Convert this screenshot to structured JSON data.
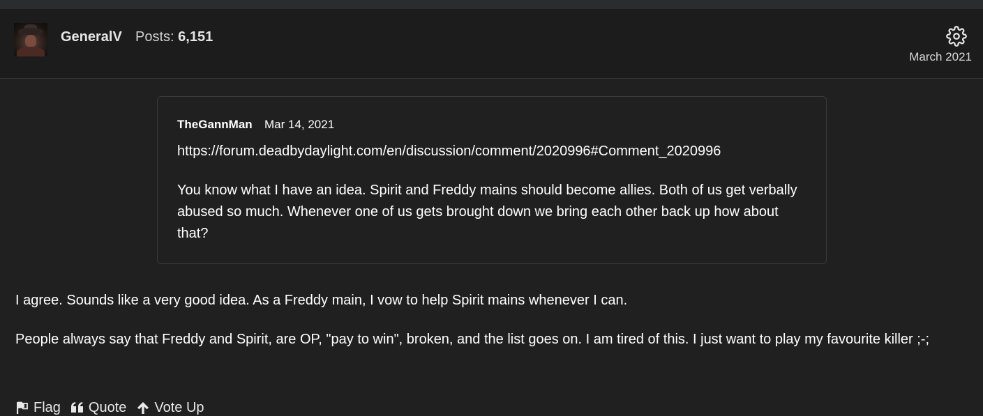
{
  "author": {
    "name": "GeneralV",
    "posts_label": "Posts:",
    "posts_count": "6,151",
    "date": "March 2021"
  },
  "quote": {
    "author": "TheGannMan",
    "date": "Mar 14, 2021",
    "link": "https://forum.deadbydaylight.com/en/discussion/comment/2020996#Comment_2020996",
    "text": "You know what I have an idea. Spirit and Freddy mains should become allies. Both of us get verbally abused so much. Whenever one of us gets brought down we bring each other back up how about that?"
  },
  "body": {
    "paragraph1": "I agree. Sounds like a very good idea. As a Freddy main, I vow to help Spirit mains whenever I can.",
    "paragraph2": "People always say that Freddy and Spirit, are OP, \"pay to win\", broken, and the list goes on. I am tired of this. I just want to play my favourite killer ;-;"
  },
  "actions": {
    "flag": "Flag",
    "quote": "Quote",
    "vote_up": "Vote Up"
  },
  "icons": {
    "settings": "gear-icon",
    "flag": "flag-icon",
    "quote": "quote-icon",
    "vote_up": "arrow-up-icon"
  },
  "colors": {
    "background": "#202020",
    "header_background": "#1c1c1c",
    "text": "#ffffff",
    "border": "#3a3a3a"
  }
}
